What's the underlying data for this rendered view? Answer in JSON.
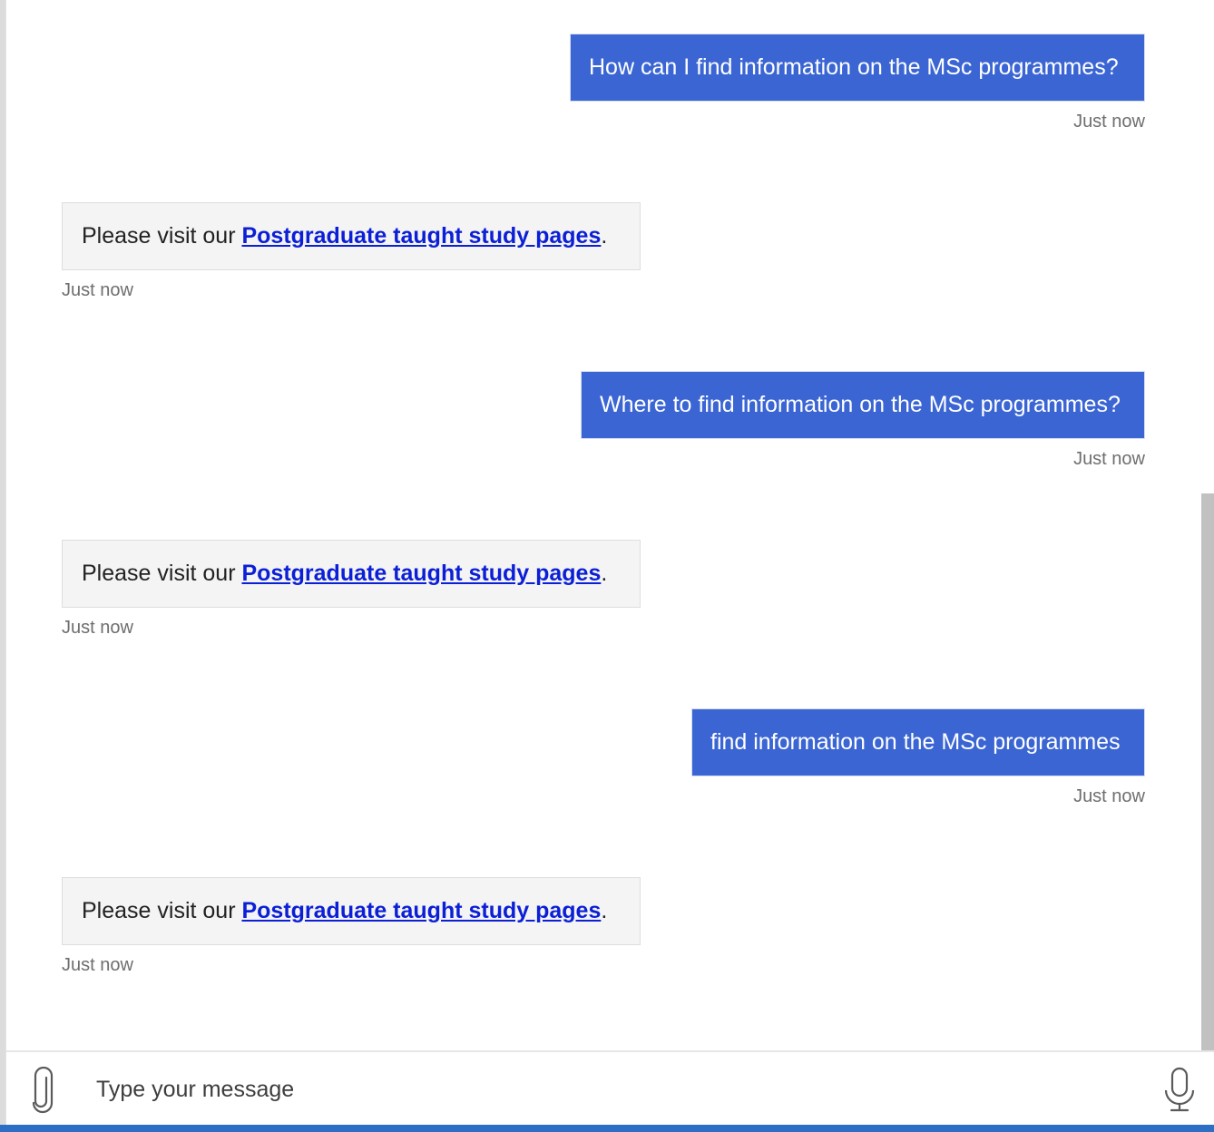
{
  "conversation": [
    {
      "from": "user",
      "text": "How can I find information on the MSc programmes?",
      "time": "Just now"
    },
    {
      "from": "bot",
      "prefix": "Please visit our ",
      "link": "Postgraduate taught study pages",
      "suffix": ".",
      "time": "Just now"
    },
    {
      "from": "user",
      "text": "Where to find information on the MSc programmes?",
      "time": "Just now"
    },
    {
      "from": "bot",
      "prefix": "Please visit our ",
      "link": "Postgraduate taught study pages",
      "suffix": ".",
      "time": "Just now"
    },
    {
      "from": "user",
      "text": "find information on the MSc programmes",
      "time": "Just now"
    },
    {
      "from": "bot",
      "prefix": "Please visit our ",
      "link": "Postgraduate taught study pages",
      "suffix": ".",
      "time": "Just now"
    }
  ],
  "composer": {
    "placeholder": "Type your message",
    "attach_icon": "paperclip-icon",
    "mic_icon": "microphone-icon"
  },
  "colors": {
    "user_bubble": "#3a65d3",
    "bot_bubble": "#f4f4f4",
    "link": "#0b1fd6",
    "accent_bar": "#2e6fc6"
  }
}
